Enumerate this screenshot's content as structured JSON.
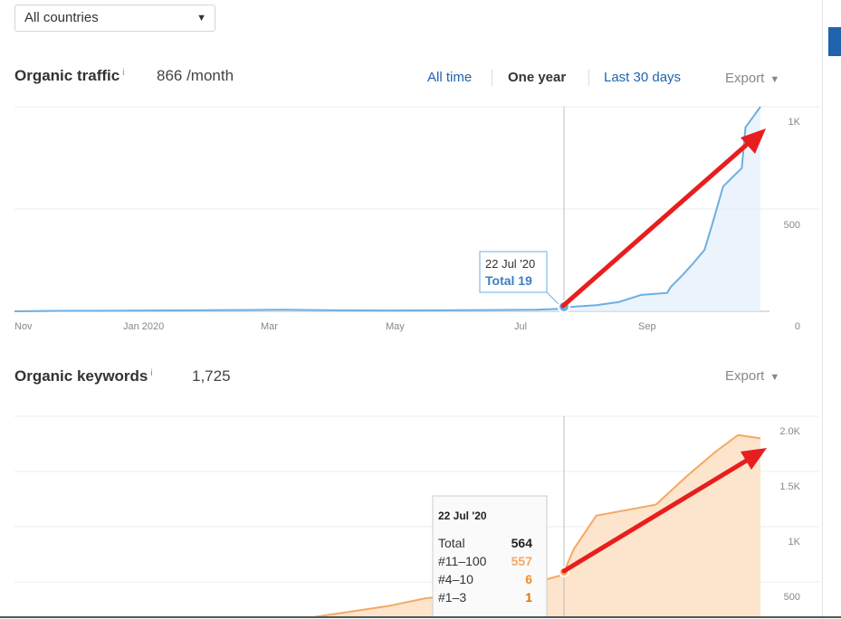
{
  "country_select": {
    "value": "All countries"
  },
  "traffic": {
    "title": "Organic traffic",
    "info": "i",
    "value": "866 /month",
    "ranges": [
      "All time",
      "One year",
      "Last 30 days"
    ],
    "active_range": "One year",
    "export_label": "Export",
    "tooltip": {
      "date": "22 Jul '20",
      "total_label": "Total 19"
    },
    "x_ticks": [
      "Nov",
      "Jan 2020",
      "Mar",
      "May",
      "Jul",
      "Sep"
    ],
    "y_ticks": [
      "1K",
      "500",
      "0"
    ]
  },
  "keywords": {
    "title": "Organic keywords",
    "info": "i",
    "value": "1,725",
    "export_label": "Export",
    "y_ticks": [
      "2.0K",
      "1.5K",
      "1K",
      "500"
    ],
    "tooltip": {
      "date": "22 Jul '20",
      "rows": [
        {
          "label": "Total",
          "value": "564",
          "color": "#222222"
        },
        {
          "label": "#11–100",
          "value": "557",
          "color": "#f5a862"
        },
        {
          "label": "#4–10",
          "value": "6",
          "color": "#f08c2a"
        },
        {
          "label": "#1–3",
          "value": "1",
          "color": "#e07000"
        }
      ]
    }
  },
  "chart_data": [
    {
      "type": "area",
      "x_ticks": [
        "Nov",
        "Jan 2020",
        "Mar",
        "May",
        "Jul",
        "Sep"
      ],
      "y_ticks": [
        "0",
        "500",
        "1K"
      ],
      "ylim": [
        0,
        1000
      ],
      "grid": true,
      "series": [
        {
          "color": "#6eaee0",
          "points": [
            [
              0,
              0
            ],
            [
              0.06,
              2
            ],
            [
              0.15,
              3
            ],
            [
              0.24,
              5
            ],
            [
              0.3,
              6
            ],
            [
              0.36,
              8
            ],
            [
              0.43,
              5
            ],
            [
              0.5,
              4
            ],
            [
              0.57,
              5
            ],
            [
              0.63,
              6
            ],
            [
              0.7,
              8
            ],
            [
              0.73,
              12
            ],
            [
              0.735,
              19
            ],
            [
              0.78,
              30
            ],
            [
              0.81,
              45
            ],
            [
              0.84,
              80
            ],
            [
              0.875,
              90
            ],
            [
              0.88,
              120
            ],
            [
              0.895,
              175
            ],
            [
              0.91,
              235
            ],
            [
              0.925,
              300
            ],
            [
              0.935,
              420
            ],
            [
              0.95,
              610
            ],
            [
              0.965,
              665
            ],
            [
              0.975,
              700
            ],
            [
              0.98,
              900
            ],
            [
              0.99,
              950
            ],
            [
              1.0,
              1000
            ]
          ]
        }
      ]
    },
    {
      "type": "area",
      "y_ticks": [
        "500",
        "1K",
        "1.5K",
        "2.0K"
      ],
      "ylim": [
        0,
        2000
      ],
      "grid": true,
      "series": [
        {
          "color": "#f5a862",
          "points": [
            [
              0,
              20
            ],
            [
              0.1,
              40
            ],
            [
              0.2,
              70
            ],
            [
              0.3,
              120
            ],
            [
              0.4,
              180
            ],
            [
              0.5,
              280
            ],
            [
              0.55,
              350
            ],
            [
              0.6,
              390
            ],
            [
              0.68,
              460
            ],
            [
              0.735,
              564
            ],
            [
              0.75,
              800
            ],
            [
              0.78,
              1100
            ],
            [
              0.82,
              1150
            ],
            [
              0.86,
              1200
            ],
            [
              0.9,
              1450
            ],
            [
              0.94,
              1680
            ],
            [
              0.97,
              1830
            ],
            [
              1.0,
              1800
            ]
          ]
        }
      ]
    }
  ]
}
